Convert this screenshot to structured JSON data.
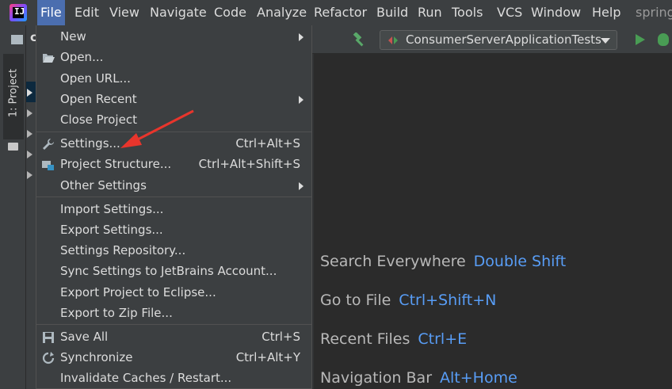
{
  "menubar": {
    "items": [
      "File",
      "Edit",
      "View",
      "Navigate",
      "Code",
      "Analyze",
      "Refactor",
      "Build",
      "Run",
      "Tools",
      "VCS",
      "Window",
      "Help",
      "spring"
    ],
    "logo_text": "IJ"
  },
  "sidebar": {
    "tab_label": "1: Project"
  },
  "project_tree": {
    "partial_label": "c"
  },
  "file_menu": {
    "new": "New",
    "open": "Open...",
    "open_url": "Open URL...",
    "open_recent": "Open Recent",
    "close_project": "Close Project",
    "settings": "Settings...",
    "settings_sc": "Ctrl+Alt+S",
    "project_structure": "Project Structure...",
    "project_structure_sc": "Ctrl+Alt+Shift+S",
    "other_settings": "Other Settings",
    "import_settings": "Import Settings...",
    "export_settings": "Export Settings...",
    "settings_repository": "Settings Repository...",
    "sync_settings": "Sync Settings to JetBrains Account...",
    "export_eclipse": "Export Project to Eclipse...",
    "export_zip": "Export to Zip File...",
    "save_all": "Save All",
    "save_all_sc": "Ctrl+S",
    "synchronize": "Synchronize",
    "synchronize_sc": "Ctrl+Alt+Y",
    "invalidate": "Invalidate Caches / Restart..."
  },
  "toolbar": {
    "run_config": "ConsumerServerApplicationTests"
  },
  "editor_hints": [
    {
      "label": "Search Everywhere",
      "key": "Double Shift"
    },
    {
      "label": "Go to File",
      "key": "Ctrl+Shift+N"
    },
    {
      "label": "Recent Files",
      "key": "Ctrl+E"
    },
    {
      "label": "Navigation Bar",
      "key": "Alt+Home"
    }
  ],
  "colors": {
    "accent": "#4b6eaf",
    "key_blue": "#589df6",
    "annotation_red": "#e8352c",
    "run_green": "#499c54"
  }
}
